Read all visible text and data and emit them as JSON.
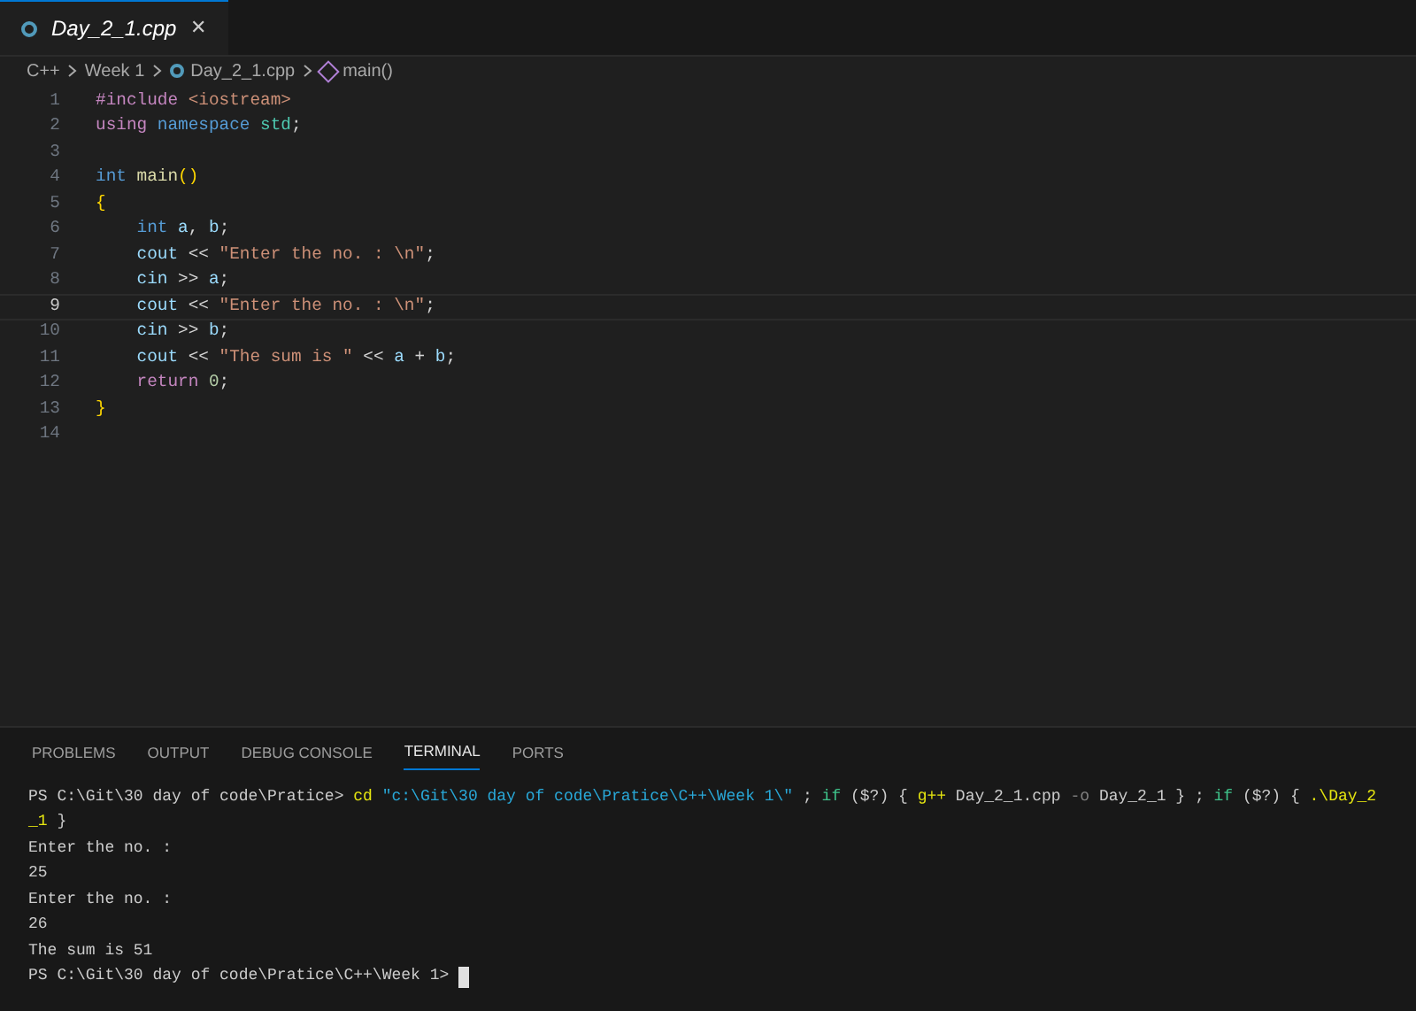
{
  "tabs": [
    {
      "label": "Day_2_1.cpp",
      "selected": true,
      "close": "✕"
    }
  ],
  "breadcrumbs": [
    {
      "label": "C++",
      "kind": "folder"
    },
    {
      "label": "Week 1",
      "kind": "folder"
    },
    {
      "label": "Day_2_1.cpp",
      "kind": "file"
    },
    {
      "label": "main()",
      "kind": "symbol"
    }
  ],
  "code_lines": [
    {
      "number": "1",
      "current": false,
      "tokens": [
        {
          "kind": "keyword",
          "text": "#include "
        },
        {
          "kind": "string",
          "text": "<iostream>"
        }
      ]
    },
    {
      "number": "2",
      "current": false,
      "tokens": [
        {
          "kind": "keyword",
          "text": "using "
        },
        {
          "kind": "type",
          "text": "namespace "
        },
        {
          "kind": "class",
          "text": "std"
        },
        {
          "kind": "plain",
          "text": ";"
        }
      ]
    },
    {
      "number": "3",
      "current": false
    },
    {
      "number": "4",
      "current": false,
      "tokens": [
        {
          "kind": "type",
          "text": "int "
        },
        {
          "kind": "function",
          "text": "main"
        },
        {
          "kind": "brace",
          "text": "()"
        }
      ]
    },
    {
      "number": "5",
      "current": false,
      "tokens": [
        {
          "kind": "brace",
          "text": "{"
        }
      ]
    },
    {
      "number": "6",
      "current": false,
      "tokens": [
        {
          "kind": "type",
          "text": "    int "
        },
        {
          "kind": "variable",
          "text": "a"
        },
        {
          "kind": "plain",
          "text": ", "
        },
        {
          "kind": "variable",
          "text": "b"
        },
        {
          "kind": "plain",
          "text": ";"
        }
      ]
    },
    {
      "number": "7",
      "current": false,
      "tokens": [
        {
          "kind": "variable",
          "text": "    cout "
        },
        {
          "kind": "plain",
          "text": "<< "
        },
        {
          "kind": "string",
          "text": "\"Enter the no. : \\n\""
        },
        {
          "kind": "plain",
          "text": ";"
        }
      ]
    },
    {
      "number": "8",
      "current": false,
      "tokens": [
        {
          "kind": "variable",
          "text": "    cin "
        },
        {
          "kind": "plain",
          "text": ">> "
        },
        {
          "kind": "variable",
          "text": "a"
        },
        {
          "kind": "plain",
          "text": ";"
        }
      ]
    },
    {
      "number": "9",
      "current": true,
      "tokens": [
        {
          "kind": "variable",
          "text": "    cout "
        },
        {
          "kind": "plain",
          "text": "<< "
        },
        {
          "kind": "string",
          "text": "\"Enter the no. : \\n\""
        },
        {
          "kind": "plain",
          "text": ";"
        }
      ]
    },
    {
      "number": "10",
      "current": false,
      "tokens": [
        {
          "kind": "variable",
          "text": "    cin "
        },
        {
          "kind": "plain",
          "text": ">> "
        },
        {
          "kind": "variable",
          "text": "b"
        },
        {
          "kind": "plain",
          "text": ";"
        }
      ]
    },
    {
      "number": "11",
      "current": false,
      "tokens": [
        {
          "kind": "variable",
          "text": "    cout "
        },
        {
          "kind": "plain",
          "text": "<< "
        },
        {
          "kind": "string",
          "text": "\"The sum is \""
        },
        {
          "kind": "plain",
          "text": " << "
        },
        {
          "kind": "variable",
          "text": "a"
        },
        {
          "kind": "plain",
          "text": " + "
        },
        {
          "kind": "variable",
          "text": "b"
        },
        {
          "kind": "plain",
          "text": ";"
        }
      ]
    },
    {
      "number": "12",
      "current": false,
      "tokens": [
        {
          "kind": "keyword",
          "text": "    return "
        },
        {
          "kind": "number",
          "text": "0"
        },
        {
          "kind": "plain",
          "text": ";"
        }
      ]
    },
    {
      "number": "13",
      "current": false,
      "tokens": [
        {
          "kind": "brace",
          "text": "}"
        }
      ]
    },
    {
      "number": "14",
      "current": false
    }
  ],
  "panel_tabs": [
    {
      "label": "PROBLEMS",
      "selected": false
    },
    {
      "label": "OUTPUT",
      "selected": false
    },
    {
      "label": "DEBUG CONSOLE",
      "selected": false
    },
    {
      "label": "TERMINAL",
      "selected": true
    },
    {
      "label": "PORTS",
      "selected": false
    }
  ],
  "terminal_lines": [
    {
      "parts": [
        {
          "kind": "prompt",
          "text": "PS C:\\Git\\30 day of code\\Pratice> "
        },
        {
          "kind": "command",
          "text": "cd "
        },
        {
          "kind": "string",
          "text": "\"c:\\Git\\30 day of code\\Pratice\\C++\\Week 1\\\""
        },
        {
          "kind": "plain",
          "text": " ; "
        },
        {
          "kind": "keyword",
          "text": "if "
        },
        {
          "kind": "plain",
          "text": "($?) { "
        },
        {
          "kind": "command",
          "text": "g++ "
        },
        {
          "kind": "plain",
          "text": "Day_2_1.cpp "
        },
        {
          "kind": "flag",
          "text": "-o "
        },
        {
          "kind": "plain",
          "text": "Day_2_1 } ; "
        },
        {
          "kind": "keyword",
          "text": "if "
        },
        {
          "kind": "plain",
          "text": "($?) { "
        },
        {
          "kind": "command",
          "text": ".\\Day_2"
        }
      ]
    },
    {
      "parts": [
        {
          "kind": "command",
          "text": "_1 "
        },
        {
          "kind": "plain",
          "text": "}"
        }
      ]
    },
    {
      "parts": [
        {
          "kind": "plain",
          "text": "Enter the no. :"
        }
      ]
    },
    {
      "parts": [
        {
          "kind": "plain",
          "text": "25"
        }
      ]
    },
    {
      "parts": [
        {
          "kind": "plain",
          "text": "Enter the no. :"
        }
      ]
    },
    {
      "parts": [
        {
          "kind": "plain",
          "text": "26"
        }
      ]
    },
    {
      "parts": [
        {
          "kind": "plain",
          "text": "The sum is 51"
        }
      ]
    },
    {
      "parts": [
        {
          "kind": "prompt",
          "text": "PS C:\\Git\\30 day of code\\Pratice\\C++\\Week 1> "
        }
      ],
      "cursor": true
    }
  ]
}
